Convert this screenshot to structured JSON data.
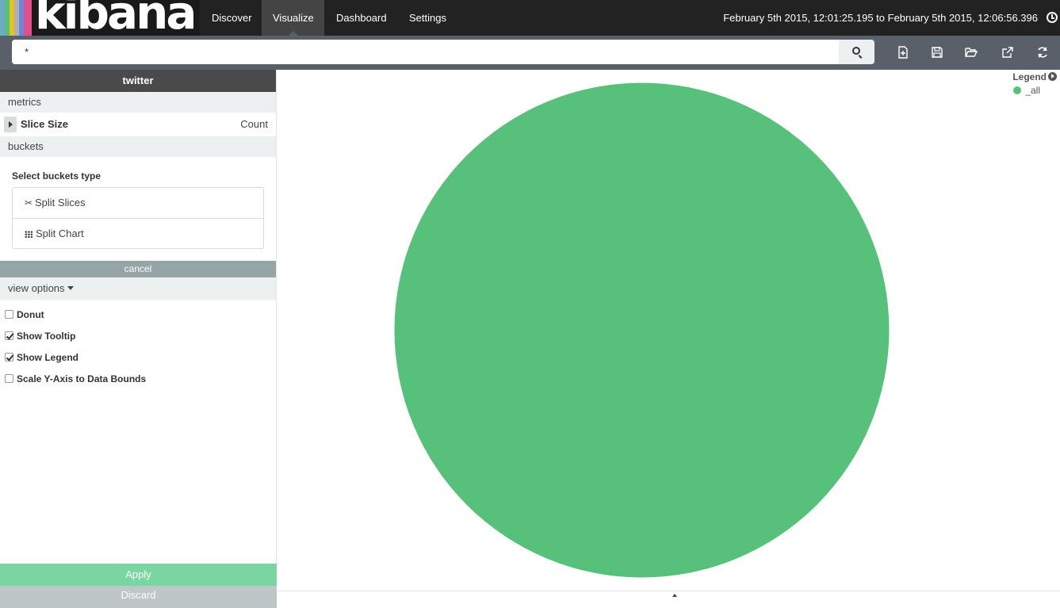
{
  "app": {
    "logo_text": "kibana"
  },
  "nav": {
    "items": [
      {
        "label": "Discover"
      },
      {
        "label": "Visualize"
      },
      {
        "label": "Dashboard"
      },
      {
        "label": "Settings"
      }
    ],
    "active": "Visualize",
    "timerange": "February 5th 2015, 12:01:25.195 to February 5th 2015, 12:06:56.396"
  },
  "search": {
    "value": "*"
  },
  "toolbar_icons": [
    "new-visualization-icon",
    "save-icon",
    "open-icon",
    "share-icon",
    "refresh-icon"
  ],
  "sidebar": {
    "index_name": "twitter",
    "metrics_label": "metrics",
    "metric": {
      "label": "Slice Size",
      "value": "Count"
    },
    "buckets_label": "buckets",
    "select_buckets_label": "Select buckets type",
    "bucket_options": [
      {
        "label": "Split Slices",
        "icon": "scissors-icon"
      },
      {
        "label": "Split Chart",
        "icon": "grid-icon"
      }
    ],
    "cancel_label": "cancel",
    "view_options_label": "view options",
    "options": [
      {
        "label": "Donut",
        "checked": false
      },
      {
        "label": "Show Tooltip",
        "checked": true
      },
      {
        "label": "Show Legend",
        "checked": true
      },
      {
        "label": "Scale Y-Axis to Data Bounds",
        "checked": false
      }
    ],
    "apply_label": "Apply",
    "discard_label": "Discard"
  },
  "legend": {
    "title": "Legend",
    "items": [
      {
        "label": "_all",
        "color": "#57c17b"
      }
    ]
  },
  "chart_data": {
    "type": "pie",
    "categories": [
      "_all"
    ],
    "values": [
      100
    ],
    "colors": [
      "#57c17b"
    ],
    "legend": "top-right"
  }
}
